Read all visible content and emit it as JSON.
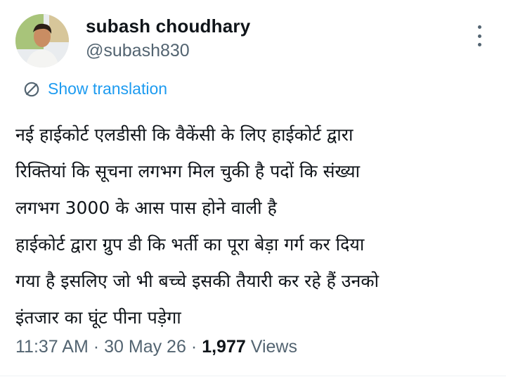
{
  "author": {
    "name": "subash choudhary",
    "handle": "@subash830"
  },
  "translate": {
    "label": "Show translation"
  },
  "tweet": {
    "lines": [
      "नई हाईकोर्ट एलडीसी कि वैकेंसी के लिए हाईकोर्ट द्वारा",
      "रिक्तियां कि सूचना लगभग मिल चुकी है पदों कि संख्या",
      "लगभग 3000 के आस पास होने वाली है",
      "हाईकोर्ट द्वारा ग्रुप डी कि भर्ती का पूरा बेड़ा गर्ग कर दिया",
      "गया है इसलिए जो भी बच्चे इसकी तैयारी कर रहे हैं उनको",
      "इंतजार का घूंट पीना पड़ेगा"
    ]
  },
  "meta": {
    "time": "11:37 AM",
    "date": "30 May 26",
    "separator": "·",
    "views_count": "1,977",
    "views_label": "Views"
  },
  "icons": {
    "more": "more-vertical-icon",
    "translate": "translate-icon"
  },
  "colors": {
    "link": "#1d9bf0",
    "secondary_text": "#536471",
    "primary_text": "#0f1419"
  }
}
